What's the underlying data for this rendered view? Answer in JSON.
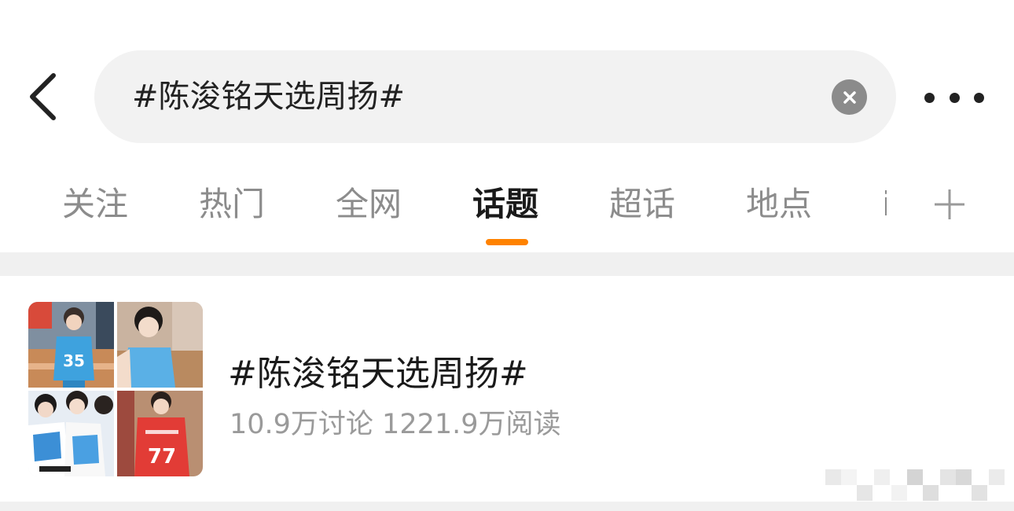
{
  "header": {
    "back_icon": "chevron-left-icon",
    "search_query": "#陈浚铭天选周扬#",
    "clear_icon": "close-circle-icon",
    "more_icon": "more-horizontal-icon"
  },
  "tabs": {
    "items": [
      {
        "label": "关注",
        "active": false
      },
      {
        "label": "热门",
        "active": false
      },
      {
        "label": "全网",
        "active": false
      },
      {
        "label": "话题",
        "active": true
      },
      {
        "label": "超话",
        "active": false
      },
      {
        "label": "地点",
        "active": false
      }
    ],
    "partial_label": "i",
    "add_icon": "plus-icon",
    "indicator_color": "#ff8200"
  },
  "topic": {
    "title": "#陈浚铭天选周扬#",
    "stats": "10.9万讨论 1221.9万阅读"
  },
  "colors": {
    "accent": "#ff8200",
    "search_bg": "#f2f2f2",
    "separator": "#f0f0f0"
  }
}
